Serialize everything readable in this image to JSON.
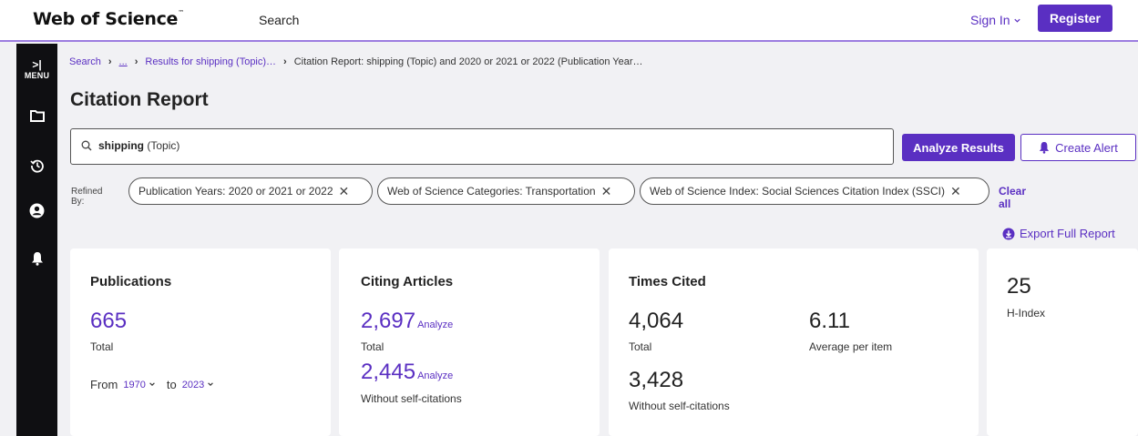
{
  "header": {
    "logo": "Web of Science",
    "logo_tm": "™",
    "search_link": "Search",
    "sign_in": "Sign In",
    "register": "Register"
  },
  "sidebar": {
    "menu_label": "MENU",
    "toggle_glyph": ">|"
  },
  "breadcrumb": {
    "items": [
      "Search",
      "...",
      "Results for shipping (Topic)…",
      "Citation Report: shipping (Topic) and 2020 or 2021 or 2022 (Publication Year…"
    ]
  },
  "page_title": "Citation Report",
  "search": {
    "term": "shipping",
    "field": "(Topic)"
  },
  "buttons": {
    "analyze": "Analyze Results",
    "create_alert": "Create Alert",
    "clear_all": "Clear all",
    "export": "Export Full Report"
  },
  "refined_by_label": "Refined By:",
  "filters": [
    "Publication Years: 2020 or 2021 or 2022",
    "Web of Science Categories: Transportation",
    "Web of Science Index: Social Sciences Citation Index (SSCI)"
  ],
  "publications": {
    "title": "Publications",
    "total": "665",
    "total_label": "Total",
    "from_label": "From",
    "from_year": "1970",
    "to_label": "to",
    "to_year": "2023"
  },
  "citing": {
    "title": "Citing Articles",
    "total": "2,697",
    "total_label": "Total",
    "without_self": "2,445",
    "without_self_label": "Without self-citations",
    "analyze": "Analyze"
  },
  "times_cited": {
    "title": "Times Cited",
    "total": "4,064",
    "total_label": "Total",
    "avg": "6.11",
    "avg_label": "Average per item",
    "without_self": "3,428",
    "without_self_label": "Without self-citations"
  },
  "hindex": {
    "value": "25",
    "label": "H-Index"
  },
  "colors": {
    "accent": "#5a2fc2",
    "sidebar": "#0f0f12"
  }
}
